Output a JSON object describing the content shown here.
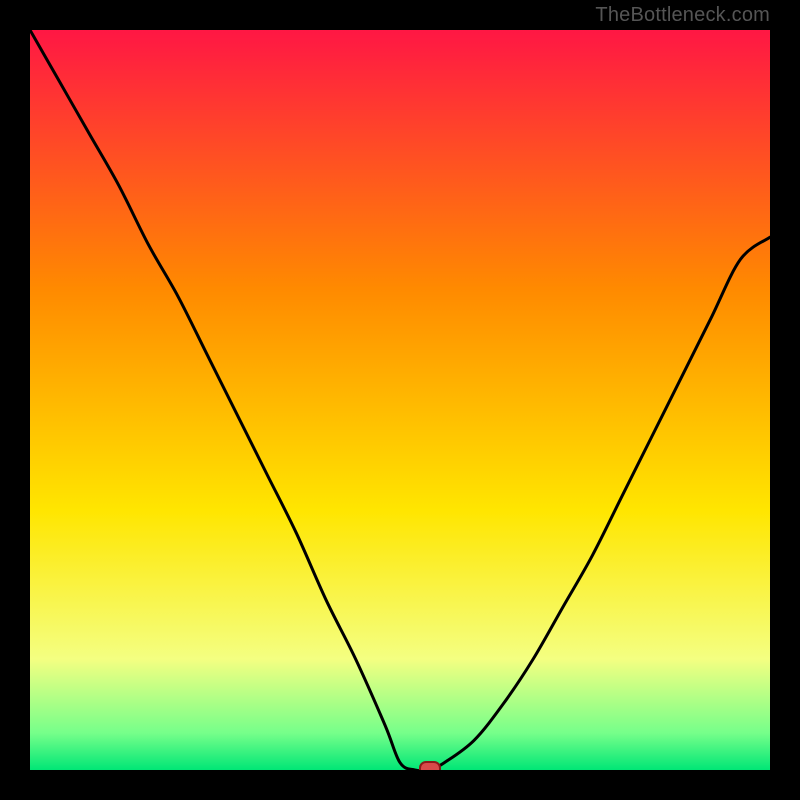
{
  "watermark": "TheBottleneck.com",
  "colors": {
    "red": "#FF1744",
    "orange": "#FF8A00",
    "yellow": "#FFE600",
    "palegreen": "#CCFF66",
    "green": "#00E676",
    "black": "#000000",
    "curve": "#000000",
    "marker_fill": "#D84A4A",
    "marker_stroke": "#8B1A1A",
    "watermark_color": "#555555"
  },
  "chart_data": {
    "type": "line",
    "title": "",
    "xlabel": "",
    "ylabel": "",
    "xlim": [
      0,
      100
    ],
    "ylim": [
      0,
      100
    ],
    "series": [
      {
        "name": "bottleneck-curve",
        "x": [
          0,
          4,
          8,
          12,
          16,
          20,
          24,
          28,
          32,
          36,
          40,
          44,
          48,
          50,
          52,
          54,
          56,
          60,
          64,
          68,
          72,
          76,
          80,
          84,
          88,
          92,
          96,
          100
        ],
        "y": [
          100,
          93,
          86,
          79,
          71,
          64,
          56,
          48,
          40,
          32,
          23,
          15,
          6,
          1,
          0,
          0,
          1,
          4,
          9,
          15,
          22,
          29,
          37,
          45,
          53,
          61,
          69,
          72
        ]
      }
    ],
    "marker": {
      "x": 54,
      "y": 0
    },
    "gradient_stops": [
      {
        "offset": 0.0,
        "color": "#FF1744"
      },
      {
        "offset": 0.35,
        "color": "#FF8A00"
      },
      {
        "offset": 0.65,
        "color": "#FFE600"
      },
      {
        "offset": 0.85,
        "color": "#F4FF81"
      },
      {
        "offset": 0.95,
        "color": "#76FF8A"
      },
      {
        "offset": 1.0,
        "color": "#00E676"
      }
    ]
  }
}
